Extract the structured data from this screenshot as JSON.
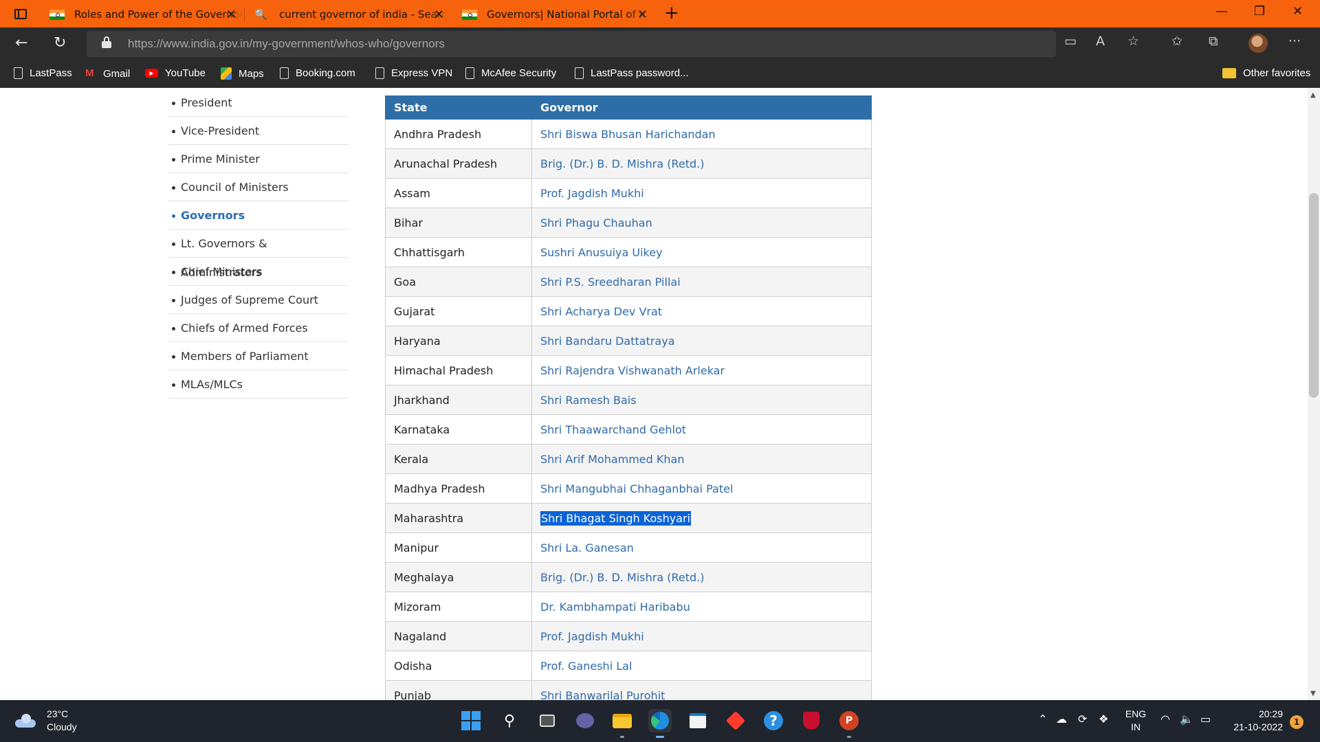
{
  "browser": {
    "tabs": [
      {
        "title": "Roles and Power of the Governor",
        "icon": "india-flag-icon",
        "active": false
      },
      {
        "title": "current governor of india - Search",
        "icon": "search-icon",
        "active": false
      },
      {
        "title": "Governors| National Portal of India",
        "icon": "india-flag-icon",
        "active": true
      }
    ],
    "url_host": "https://www.india.gov.in",
    "url_path": "/my-government/whos-who/governors",
    "accent_color": "#f7630c"
  },
  "bookmarks": [
    {
      "label": "LastPass",
      "icon": "page-icon"
    },
    {
      "label": "Gmail",
      "icon": "gmail-icon"
    },
    {
      "label": "YouTube",
      "icon": "youtube-icon"
    },
    {
      "label": "Maps",
      "icon": "maps-icon"
    },
    {
      "label": "Booking.com",
      "icon": "page-icon"
    },
    {
      "label": "Express VPN",
      "icon": "page-icon"
    },
    {
      "label": "McAfee Security",
      "icon": "page-icon"
    },
    {
      "label": "LastPass password...",
      "icon": "page-icon"
    }
  ],
  "other_favorites": "Other favorites",
  "sidenav": {
    "items": [
      "President",
      "Vice-President",
      "Prime Minister",
      "Council of Ministers",
      "Governors",
      "Lt. Governors & Administrators",
      "Chief Ministers",
      "Judges of Supreme Court",
      "Chiefs of Armed Forces",
      "Members of Parliament",
      "MLAs/MLCs"
    ],
    "active": "Governors"
  },
  "table": {
    "headers": {
      "state": "State",
      "governor": "Governor"
    },
    "rows": [
      {
        "state": "Andhra Pradesh",
        "governor": "Shri Biswa Bhusan Harichandan"
      },
      {
        "state": "Arunachal Pradesh",
        "governor": "Brig. (Dr.) B. D. Mishra (Retd.)"
      },
      {
        "state": "Assam",
        "governor": "Prof. Jagdish Mukhi"
      },
      {
        "state": "Bihar",
        "governor": "Shri Phagu Chauhan"
      },
      {
        "state": "Chhattisgarh",
        "governor": "Sushri Anusuiya Uikey"
      },
      {
        "state": "Goa",
        "governor": "Shri P.S. Sreedharan Pillai"
      },
      {
        "state": "Gujarat",
        "governor": "Shri Acharya Dev Vrat"
      },
      {
        "state": "Haryana",
        "governor": "Shri Bandaru Dattatraya"
      },
      {
        "state": "Himachal Pradesh",
        "governor": "Shri Rajendra Vishwanath Arlekar"
      },
      {
        "state": "Jharkhand",
        "governor": "Shri Ramesh Bais"
      },
      {
        "state": "Karnataka",
        "governor": "Shri Thaawarchand Gehlot"
      },
      {
        "state": "Kerala",
        "governor": "Shri Arif Mohammed Khan"
      },
      {
        "state": "Madhya Pradesh",
        "governor": "Shri Mangubhai Chhaganbhai Patel"
      },
      {
        "state": "Maharashtra",
        "governor": "Shri Bhagat Singh Koshyari",
        "selected": true
      },
      {
        "state": "Manipur",
        "governor": "Shri La. Ganesan"
      },
      {
        "state": "Meghalaya",
        "governor": "Brig. (Dr.) B. D. Mishra (Retd.)"
      },
      {
        "state": "Mizoram",
        "governor": "Dr. Kambhampati Haribabu"
      },
      {
        "state": "Nagaland",
        "governor": "Prof. Jagdish Mukhi"
      },
      {
        "state": "Odisha",
        "governor": "Prof. Ganeshi Lal"
      },
      {
        "state": "Punjab",
        "governor": "Shri Banwarilal Purohit"
      }
    ]
  },
  "taskbar": {
    "weather_temp": "23°C",
    "weather_desc": "Cloudy",
    "lang_line1": "ENG",
    "lang_line2": "IN",
    "time": "20:29",
    "date": "21-10-2022",
    "notification_count": "1"
  }
}
